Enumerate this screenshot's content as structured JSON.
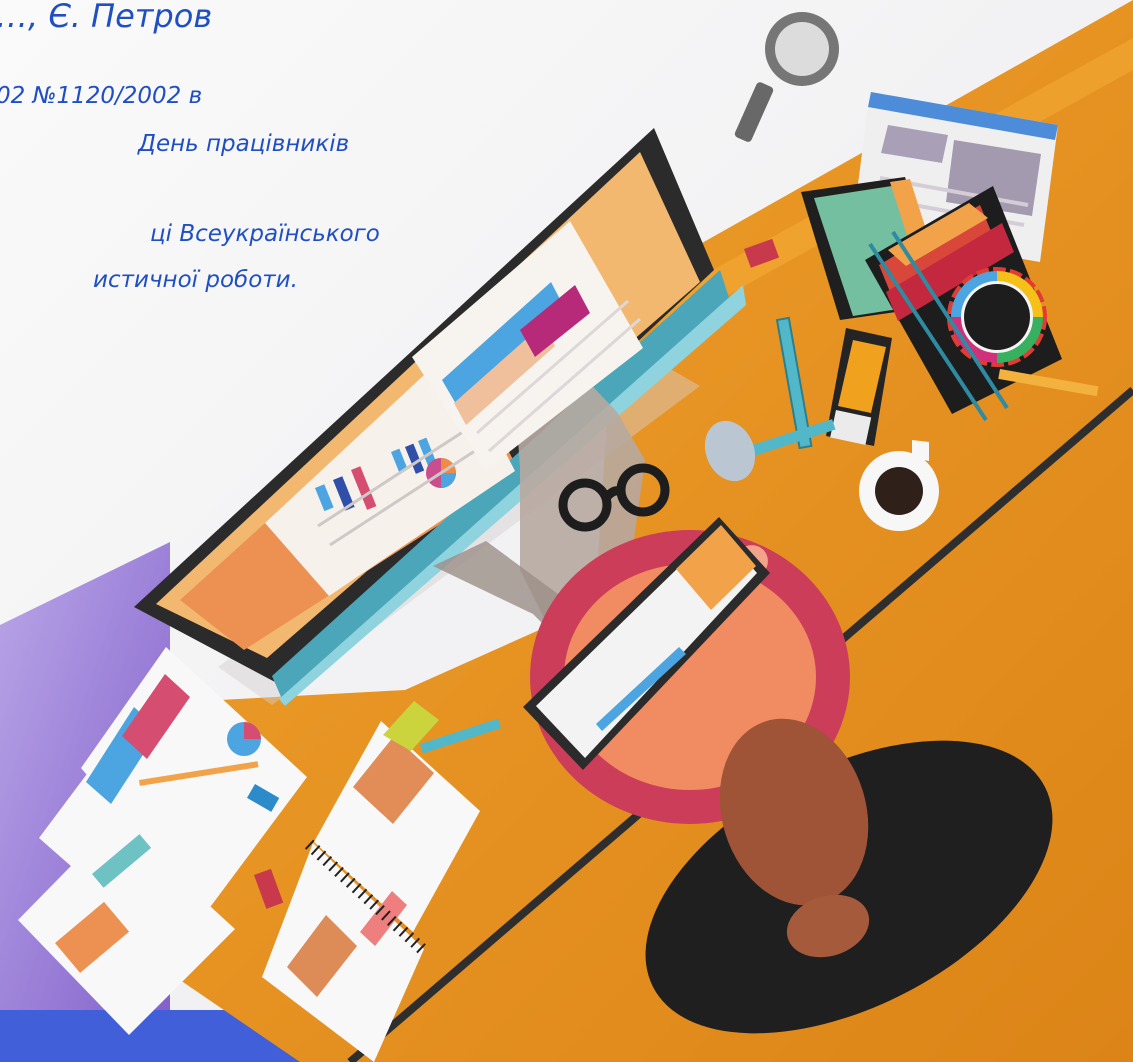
{
  "slide": {
    "text_lines": [
      "…, Є. Петров",
      "02 №1120/2002 в",
      "День працівників",
      "ці Всеукраїнського",
      "истичної роботи."
    ]
  },
  "illustration": {
    "icon": "workspace-illustration",
    "palette": {
      "desk": "#ed9d2b",
      "desk_shadow": "#d98618",
      "monitor_frame": "#2d2d2d",
      "screen_left": "#ec9151",
      "screen_right": "#f3b86f",
      "accent_teal": "#52b7c8",
      "accent_pink": "#d64d72",
      "accent_blue": "#4ca5e0",
      "accent_magenta": "#bd2a7a",
      "dark": "#202124",
      "corner_purple": "#8d70cf"
    }
  }
}
